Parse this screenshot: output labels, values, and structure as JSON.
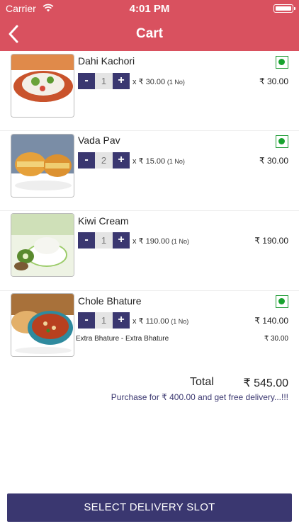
{
  "status_bar": {
    "carrier": "Carrier",
    "time": "4:01 PM"
  },
  "nav": {
    "title": "Cart",
    "back_icon": "chevron-left-icon"
  },
  "currency": "₹",
  "items": [
    {
      "name": "Dahi Kachori",
      "qty": "1",
      "unit_price": "x ₹ 30.00",
      "unit_note": "(1 No)",
      "line_total": "₹ 30.00",
      "veg": true,
      "image": "dahi-kachori-photo"
    },
    {
      "name": "Vada Pav",
      "qty": "2",
      "unit_price": "x ₹ 15.00",
      "unit_note": "(1 No)",
      "line_total": "₹ 30.00",
      "veg": true,
      "image": "vada-pav-photo"
    },
    {
      "name": "Kiwi Cream",
      "qty": "1",
      "unit_price": "x ₹ 190.00",
      "unit_note": "(1 No)",
      "line_total": "₹ 190.00",
      "veg": false,
      "image": "kiwi-cream-photo"
    },
    {
      "name": "Chole Bhature",
      "qty": "1",
      "unit_price": "x ₹ 110.00",
      "unit_note": "(1 No)",
      "line_total": "₹ 140.00",
      "veg": true,
      "image": "chole-bhature-photo",
      "extra": {
        "label": "Extra Bhature - Extra Bhature",
        "price": "₹ 30.00"
      }
    }
  ],
  "stepper": {
    "minus": "-",
    "plus": "+"
  },
  "summary": {
    "total_label": "Total",
    "total_value": "₹ 545.00",
    "promo": "Purchase for ₹ 400.00 and get free delivery...!!!"
  },
  "cta": {
    "label": "SELECT DELIVERY SLOT"
  },
  "colors": {
    "header": "#d9515f",
    "primary": "#3a3770",
    "veg_green": "#18a32f"
  }
}
